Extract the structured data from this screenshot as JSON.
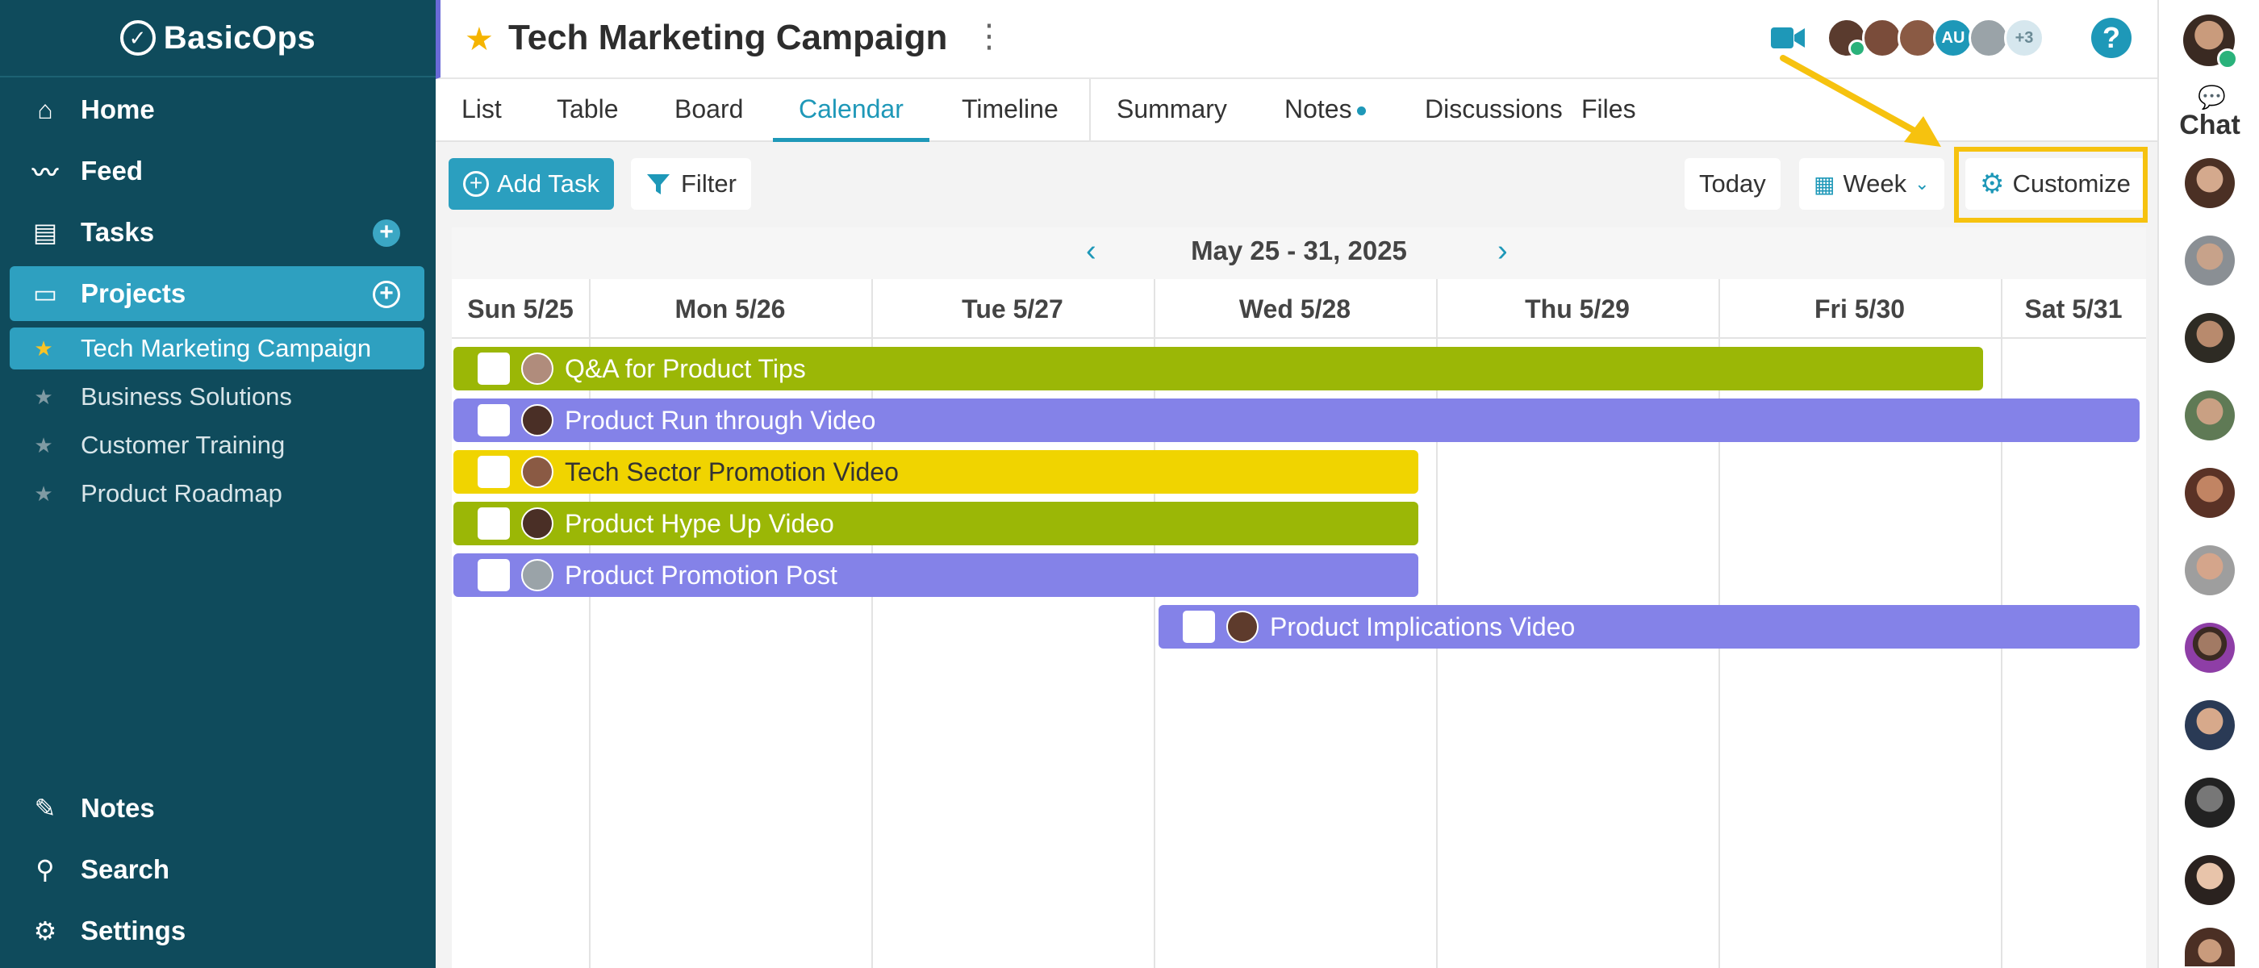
{
  "app": {
    "name": "BasicOps"
  },
  "sidebar": {
    "nav": [
      {
        "label": "Home",
        "icon": "home-icon"
      },
      {
        "label": "Feed",
        "icon": "activity-icon"
      },
      {
        "label": "Tasks",
        "icon": "clipboard-icon"
      },
      {
        "label": "Projects",
        "icon": "folder-icon"
      }
    ],
    "projects": [
      {
        "label": "Tech Marketing Campaign",
        "active": true
      },
      {
        "label": "Business Solutions"
      },
      {
        "label": "Customer Training"
      },
      {
        "label": "Product Roadmap"
      }
    ],
    "bottom": [
      {
        "label": "Notes",
        "icon": "pencil-icon"
      },
      {
        "label": "Search",
        "icon": "search-icon"
      },
      {
        "label": "Settings",
        "icon": "gear-icon"
      }
    ]
  },
  "header": {
    "title": "Tech Marketing Campaign",
    "members_extra": "+3",
    "member_initials": "AU"
  },
  "tabs": [
    "List",
    "Table",
    "Board",
    "Calendar",
    "Timeline",
    "Summary",
    "Notes",
    "Discussions",
    "Files"
  ],
  "toolbar": {
    "add_task": "Add Task",
    "filter": "Filter",
    "today": "Today",
    "view": "Week",
    "customize": "Customize"
  },
  "calendar": {
    "range": "May 25 - 31, 2025",
    "days": [
      "Sun 5/25",
      "Mon 5/26",
      "Tue 5/27",
      "Wed 5/28",
      "Thu 5/29",
      "Fri 5/30",
      "Sat 5/31"
    ],
    "tasks": [
      {
        "title": "Q&A for Product Tips",
        "color": "#9bb706"
      },
      {
        "title": "Product Run through Video",
        "color": "#8482e8"
      },
      {
        "title": "Tech Sector Promotion Video",
        "color": "#f0d400"
      },
      {
        "title": "Product Hype Up Video",
        "color": "#9bb706"
      },
      {
        "title": "Product Promotion Post",
        "color": "#8482e8"
      },
      {
        "title": "Product Implications Video",
        "color": "#8482e8"
      }
    ]
  },
  "chat": {
    "label": "Chat"
  },
  "colors": {
    "sidebar": "#0f4b5c",
    "accent": "#1e98b8",
    "highlight": "#f6c20f"
  }
}
